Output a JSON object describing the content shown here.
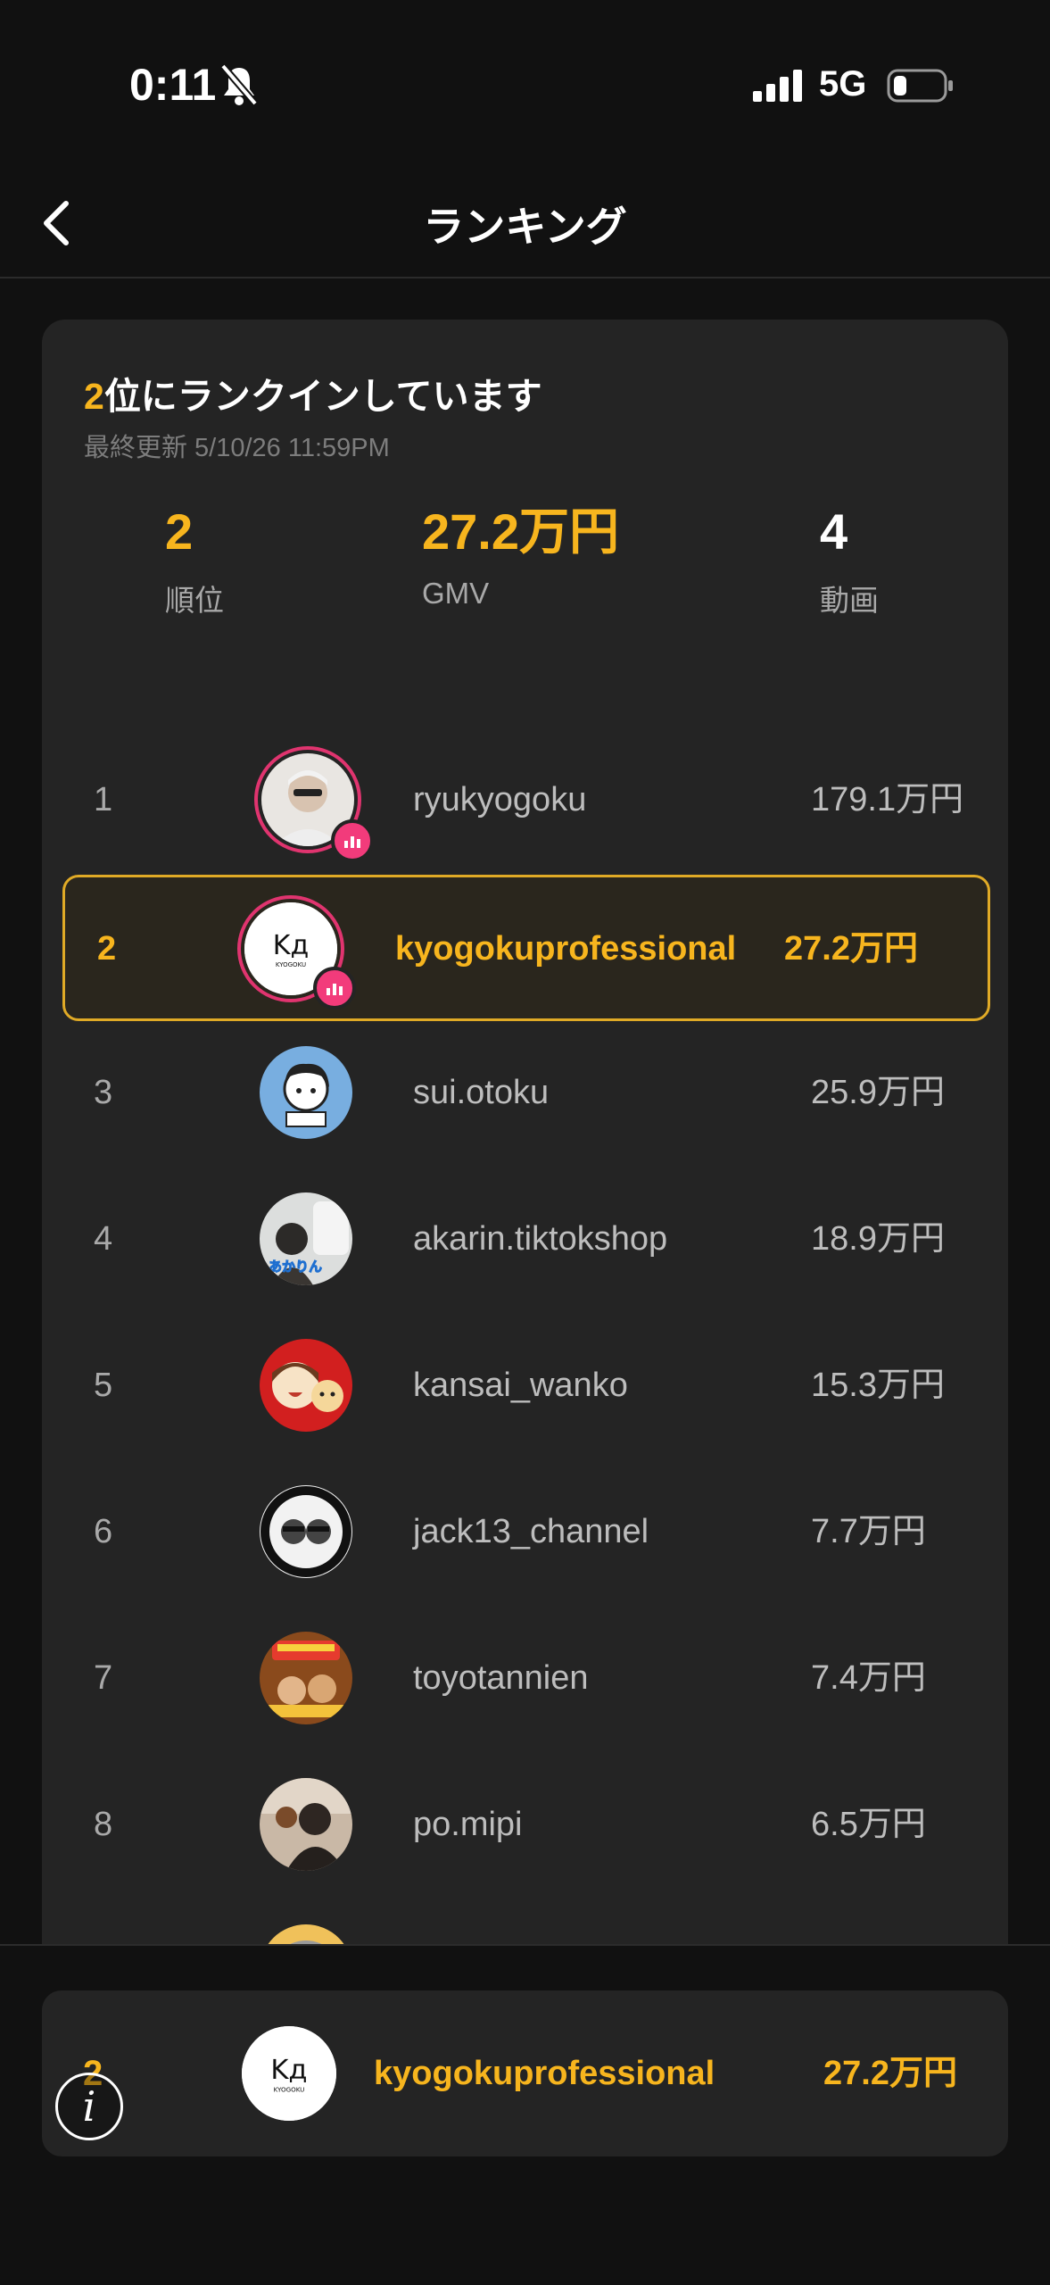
{
  "status_bar": {
    "time": "0:11",
    "network": "5G"
  },
  "header": {
    "title": "ランキング"
  },
  "summary": {
    "headline_rank": "2",
    "headline_text": "位にランクインしています",
    "updated": "最終更新 5/10/26 11:59PM",
    "stats": {
      "rank_value": "2",
      "rank_label": "順位",
      "gmv_value": "27.2万円",
      "gmv_label": "GMV",
      "videos_value": "4",
      "videos_label": "動画"
    }
  },
  "ranking": [
    {
      "rank": "1",
      "name": "ryukyogoku",
      "gmv": "179.1万円"
    },
    {
      "rank": "2",
      "name": "kyogokuprofessional",
      "gmv": "27.2万円"
    },
    {
      "rank": "3",
      "name": "sui.otoku",
      "gmv": "25.9万円"
    },
    {
      "rank": "4",
      "name": "akarin.tiktokshop",
      "gmv": "18.9万円"
    },
    {
      "rank": "5",
      "name": "kansai_wanko",
      "gmv": "15.3万円"
    },
    {
      "rank": "6",
      "name": "jack13_channel",
      "gmv": "7.7万円"
    },
    {
      "rank": "7",
      "name": "toyotannien",
      "gmv": "7.4万円"
    },
    {
      "rank": "8",
      "name": "po.mipi",
      "gmv": "6.5万円"
    }
  ],
  "my_rank": {
    "rank": "2",
    "name": "kyogokuprofessional",
    "gmv": "27.2万円"
  },
  "avatar_text": {
    "logo": "Kд",
    "logo_sub": "KYOGOKU",
    "akarin": "あかりん"
  },
  "colors": {
    "accent": "#f7b51e",
    "live": "#f23b7b",
    "background": "#111111",
    "card": "#242424"
  },
  "icons": {
    "back": "chevron-left-icon",
    "mute": "bell-slash-icon",
    "info": "info-icon"
  }
}
